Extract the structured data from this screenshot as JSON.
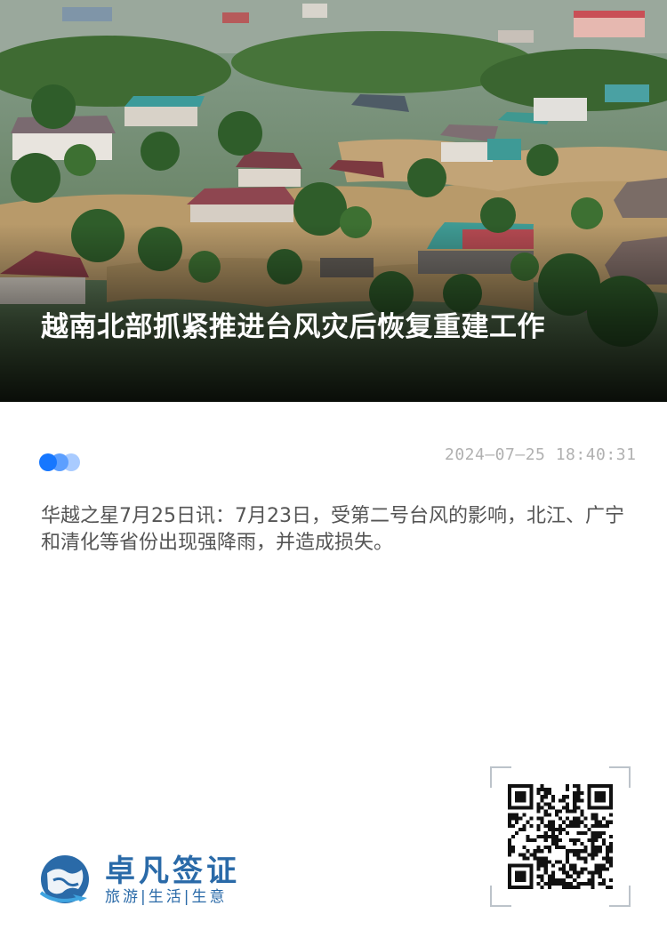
{
  "article": {
    "title": "越南北部抓紧推进台风灾后恢复重建工作",
    "datetime": "2024—07—25 18:40:31",
    "body": "华越之星7月25日讯：7月23日，受第二号台风的影响，北江、广宁和清化等省份出现强降雨，并造成损失。"
  },
  "hero": {
    "image_icon": "flooded-village-photo"
  },
  "pager": {
    "icon": "carousel-dots-icon",
    "colors": [
      "#1677ff",
      "#5c9fff",
      "#a9cbff"
    ]
  },
  "brand": {
    "name": "卓凡签证",
    "slogan": "旅游|生活|生意",
    "logo_icon": "globe-plane-logo",
    "color": "#2a6aa8"
  },
  "qr": {
    "icon": "qr-code-icon"
  }
}
